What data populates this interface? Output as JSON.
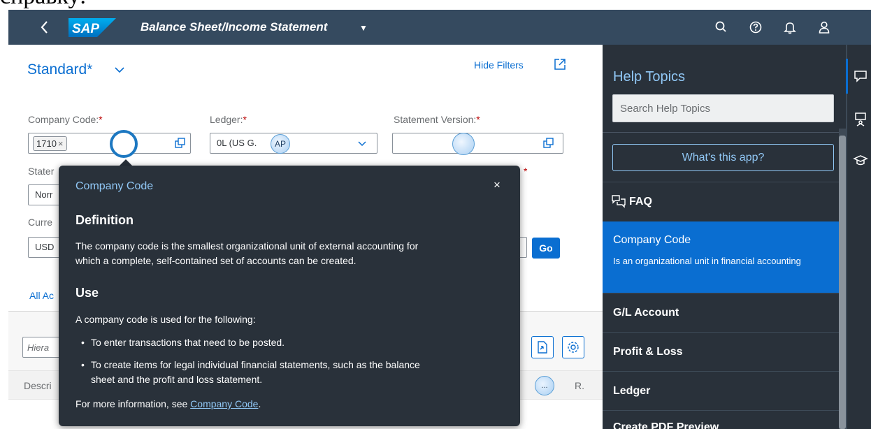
{
  "caption": "справку:",
  "shell": {
    "title": "Balance Sheet/Income Statement",
    "logo": "SAP",
    "icons": [
      "back-icon",
      "search-icon",
      "help-icon",
      "bell-icon",
      "user-icon"
    ]
  },
  "variant": {
    "label": "Standard*"
  },
  "toolbar": {
    "hide_filters": "Hide Filters"
  },
  "filters": {
    "company_code": {
      "label": "Company Code:",
      "required": "*",
      "token": "1710",
      "token_remove": "×"
    },
    "ledger": {
      "label": "Ledger:",
      "required": "*",
      "value": "0L (US G.",
      "overlay": "AP"
    },
    "statement_version": {
      "label": "Statement Version:",
      "required": "*",
      "value": ""
    },
    "statement_type": {
      "label_partial": "Stater",
      "value_partial": "Norr",
      "required": "*"
    },
    "currency": {
      "label_partial": "Curre",
      "value_partial": "USD"
    },
    "go_label": "Go"
  },
  "tabs": {
    "active_partial": "All Ac"
  },
  "table": {
    "search_placeholder_partial": "Hiera",
    "col_description_partial": "Descri",
    "col_more": "...",
    "col_r": "R."
  },
  "popover": {
    "title": "Company Code",
    "close": "×",
    "definition_heading": "Definition",
    "definition_line1": "The company code is the smallest organizational unit of external accounting for",
    "definition_line2": "which a complete, self-contained set of accounts can be created.",
    "use_heading": "Use",
    "use_intro": "A company code is used for the following:",
    "bullet": "•",
    "bullet1": "To enter transactions that need to be posted.",
    "bullet2_line1": "To create items for legal individual financial statements, such as the balance",
    "bullet2_line2": "sheet and the profit and loss statement.",
    "more_prefix": "For more information, see ",
    "more_link": "Company Code",
    "more_suffix": "."
  },
  "help": {
    "title": "Help Topics",
    "search_placeholder": "Search Help Topics",
    "whats_this_app": "What's this app?",
    "items": [
      {
        "title": "FAQ"
      },
      {
        "title": "Company Code",
        "subtitle": "Is an organizational unit in financial accounting"
      },
      {
        "title": "G/L Account"
      },
      {
        "title": "Profit & Loss"
      },
      {
        "title": "Ledger"
      },
      {
        "title": "Create PDF Preview"
      }
    ]
  },
  "colors": {
    "shell": "#354a5f",
    "accent": "#0a6ed1",
    "panel": "#29313a",
    "link_on_dark": "#91c8f6",
    "required": "#bb0000"
  }
}
